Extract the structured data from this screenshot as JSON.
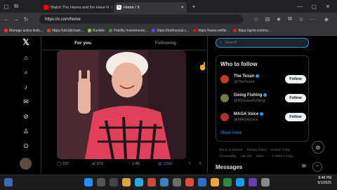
{
  "browser": {
    "tabs": [
      {
        "label": "Watch The Haves and the Have N",
        "active": false
      },
      {
        "label": "Home / X",
        "active": true
      }
    ],
    "new_tab_symbol": "+",
    "url": "https://x.com/home",
    "bookmarks": [
      "Manage active listin...",
      "https://old.bitchute...",
      "Rumble",
      "Fidelity Investments...",
      "https://truthsocial.c...",
      "https://www.netflix...",
      "https://gettr.com/us..."
    ]
  },
  "x": {
    "tabs": {
      "for_you": "For you",
      "following": "Following"
    },
    "post_actions": {
      "replies": "237",
      "reposts": "979",
      "likes": "2.4K",
      "views": "135K"
    },
    "search_placeholder": "Search",
    "who_to_follow": {
      "title": "Who to follow",
      "accounts": [
        {
          "name": "The Texan",
          "handle": "@TheTexan",
          "button": "Follow",
          "avatar_color": "#c0392b"
        },
        {
          "name": "Going Fishing",
          "handle": "@B1itzseaFishing",
          "button": "Follow",
          "avatar_color": "#6d7b4a"
        },
        {
          "name": "MAGA Voice",
          "handle": "@MAGAVoice",
          "button": "Follow",
          "avatar_color": "#b03030"
        }
      ],
      "show_more": "Show more"
    },
    "footer_links": [
      "Terms of Service",
      "Privacy Policy",
      "Cookie Policy",
      "Accessibility",
      "Ads info",
      "More ···",
      "© 2025 X Corp."
    ],
    "messages_label": "Messages"
  },
  "taskbar": {
    "time": "8:48 PM",
    "date": "5/1/2025"
  },
  "colors": {
    "accent": "#1d9bf0",
    "background": "#000000",
    "border": "#2f3336"
  }
}
